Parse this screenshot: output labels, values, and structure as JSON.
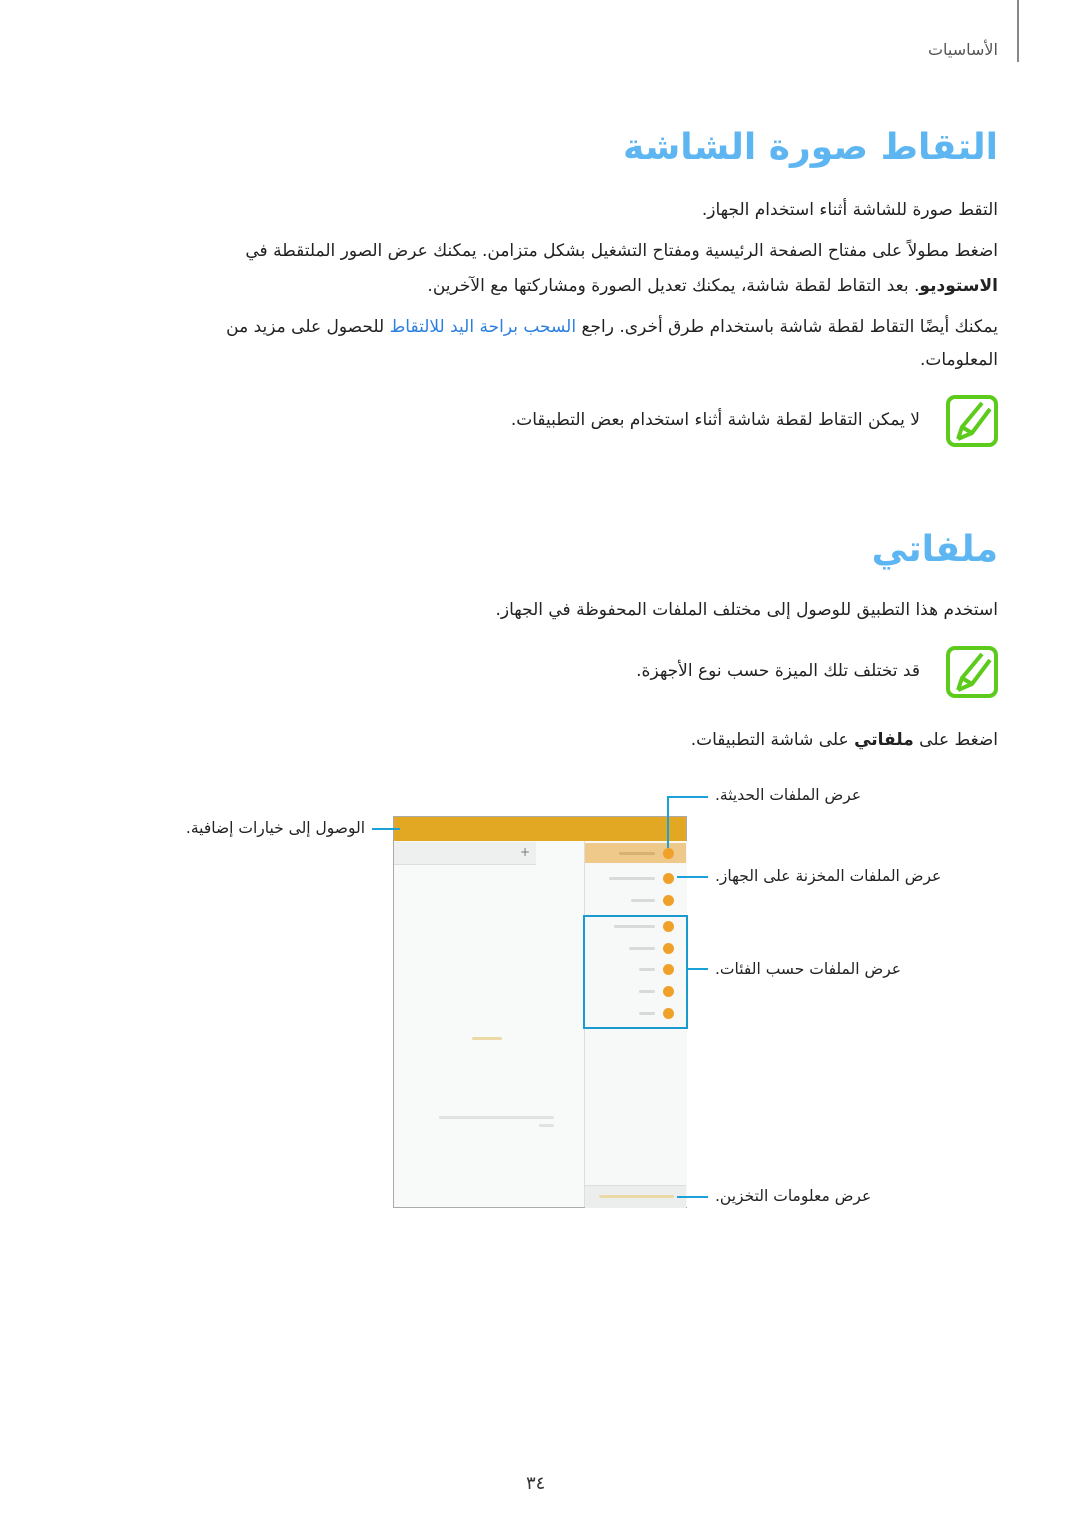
{
  "header": {
    "section": "الأساسيات"
  },
  "screenshot_section": {
    "title": "التقاط صورة الشاشة",
    "intro": "التقط صورة للشاشة أثناء استخدام الجهاز.",
    "p1_line1": "اضغط مطولاً على مفتاح الصفحة الرئيسية ومفتاح التشغيل بشكل متزامن. يمكنك عرض الصور الملتقطة في",
    "p1_bold": "الاستوديو",
    "p1_line2_rest": ". بعد التقاط لقطة شاشة، يمكنك تعديل الصورة ومشاركتها مع الآخرين.",
    "p2_before": "يمكنك أيضًا التقاط لقطة شاشة باستخدام طرق أخرى. راجع ",
    "p2_link": "السحب براحة اليد للالتقاط",
    "p2_after": " للحصول على مزيد من",
    "p2_line2": "المعلومات.",
    "note": "لا يمكن التقاط لقطة شاشة أثناء استخدام بعض التطبيقات."
  },
  "myfiles_section": {
    "title": "ملفاتي",
    "intro": "استخدم هذا التطبيق للوصول إلى مختلف الملفات المحفوظة في الجهاز.",
    "note": "قد تختلف تلك الميزة حسب نوع الأجهزة.",
    "step_before": "اضغط على ",
    "step_bold": "ملفاتي",
    "step_after": " على شاشة التطبيقات."
  },
  "figure": {
    "callouts": {
      "recent": "عرض الملفات الحديثة.",
      "device": "عرض الملفات المخزنة على الجهاز.",
      "categories": "عرض الملفات حسب الفئات.",
      "storage": "عرض معلومات التخزين.",
      "more_options": "الوصول إلى خيارات إضافية."
    },
    "add_tab_symbol": "+"
  },
  "colors": {
    "title": "#5db6f2",
    "link": "#2a7fe0",
    "note_icon": "#5ccb1b",
    "callout": "#1ba0d7",
    "app_bar": "#e3a823"
  },
  "icons": {
    "note": "note-pen-icon"
  },
  "footer": {
    "page_number": "٣٤"
  }
}
